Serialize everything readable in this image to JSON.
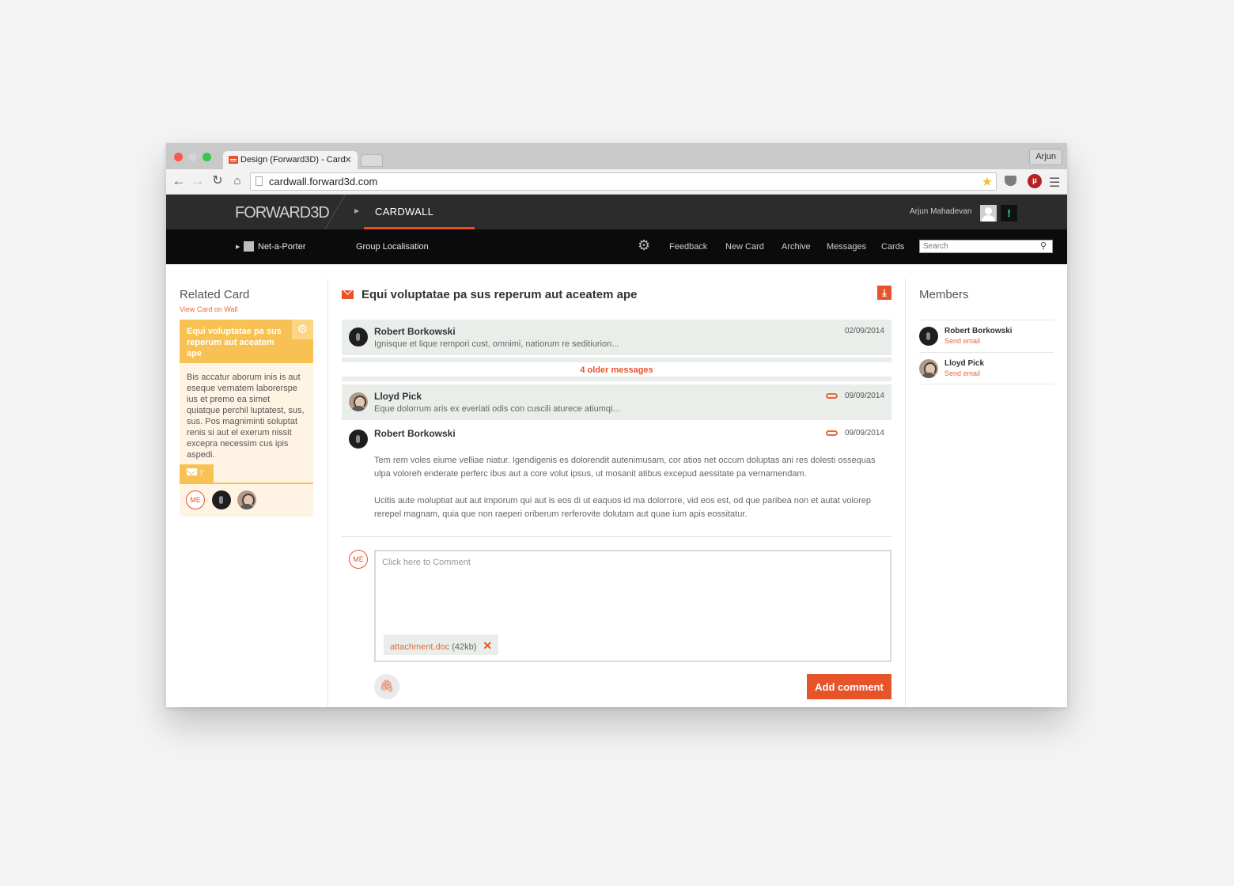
{
  "browser": {
    "tab_title": "Design (Forward3D) - Card",
    "url": "cardwall.forward3d.com",
    "profile_name": "Arjun"
  },
  "header": {
    "logo_text": "FORWARD3D",
    "app_name": "CARDWALL",
    "user_name": "Arjun Mahadevan",
    "alert_icon": "!"
  },
  "subnav": {
    "client": "Net-a-Porter",
    "group": "Group Localisation",
    "links": [
      "Feedback",
      "New Card",
      "Archive",
      "Messages",
      "Cards"
    ],
    "search_placeholder": "Search"
  },
  "related_card": {
    "heading": "Related Card",
    "view_link": "View Card on Wall",
    "title": "Equi voluptatae pa sus reperum aut aceatem ape",
    "body": "Bis accatur aborum inis is aut eseque vernatem laborerspe ius et premo ea simet quiatque perchil luptatest, sus, sus. Pos magniminti soluptat renis si aut el exerum nissit excepra necessim cus ipis aspedi.",
    "message_count": "7",
    "me_label": "ME"
  },
  "thread": {
    "title": "Equi voluptatae pa sus reperum aut aceatem ape",
    "older_messages": "4 older messages",
    "messages": [
      {
        "name": "Robert Borkowski",
        "date": "02/09/2014",
        "preview": "Ignisque et lique rempori cust, omnimi, natiorum re seditiurion..."
      },
      {
        "name": "Lloyd Pick",
        "date": "09/09/2014",
        "preview": "Eque dolorrum aris ex everiati odis con cuscili aturece atiumqi..."
      },
      {
        "name": "Robert Borkowski",
        "date": "09/09/2014",
        "paragraphs": [
          "Tem rem voles eiume velliae niatur. Igendigenis es dolorendit autenimusam, cor atios net occum doluptas ani res dolesti ossequas ulpa voloreh enderate perferc ibus aut a core volut ipsus, ut mosanit atibus excepud aessitate pa vernamendam.",
          "Ucitis aute moluptiat aut aut imporum qui aut is eos di ut eaquos id ma dolorrore, vid eos est, od que paribea non et autat volorep rerepel magnam, quia que non raeperi oriberum rerferovite dolutam aut quae ium apis eossitatur."
        ]
      }
    ]
  },
  "composer": {
    "me_label": "ME",
    "placeholder": "Click here to Comment",
    "attachment_name": "attachment.doc",
    "attachment_size": "(42kb)",
    "submit_label": "Add comment"
  },
  "members": {
    "heading": "Members",
    "list": [
      {
        "name": "Robert Borkowski",
        "action": "Send email"
      },
      {
        "name": "Lloyd Pick",
        "action": "Send email"
      }
    ]
  },
  "colors": {
    "accent": "#e8542a",
    "card_yellow": "#f8c153",
    "card_bg": "#fff4e4",
    "message_bg": "#eaeeea",
    "header_dark": "#2c2c2c",
    "subnav_black": "#0b0b0b"
  }
}
